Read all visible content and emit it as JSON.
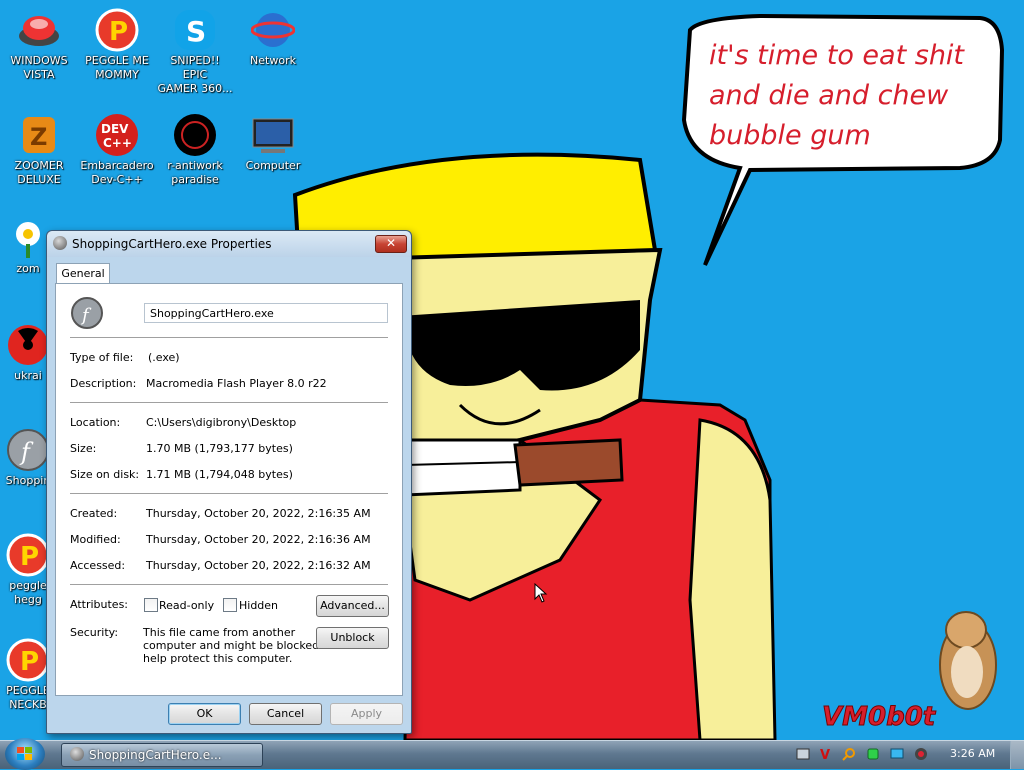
{
  "wallpaper": {
    "speech_lines": [
      "it's time to eat shit",
      "and die and chew",
      "bubble gum"
    ],
    "watermark": "VM0b0t"
  },
  "desktop_icons": [
    {
      "label": "WINDOWS\nVISTA",
      "icon": "vista-dome-icon"
    },
    {
      "label": "PEGGLE ME\nMOMMY",
      "icon": "peggle-icon"
    },
    {
      "label": "SNIPED!! EPIC\nGAMER 360...",
      "icon": "skype-icon"
    },
    {
      "label": "Network",
      "icon": "network-globe-icon"
    },
    {
      "label": "ZOOMER\nDELUXE",
      "icon": "zoomer-icon"
    },
    {
      "label": "Embarcadero\nDev-C++",
      "icon": "devcpp-icon"
    },
    {
      "label": "r-antiwork\nparadise",
      "icon": "antiwork-icon"
    },
    {
      "label": "Computer",
      "icon": "computer-icon"
    },
    {
      "label": "zom",
      "icon": "flower-icon"
    },
    {
      "label": "ukrai",
      "icon": "radiation-icon"
    },
    {
      "label": "Shoppin",
      "icon": "flash-icon"
    },
    {
      "label": "peggle\nhegg",
      "icon": "peggle-icon"
    },
    {
      "label": "PEGGLE\nNECKB",
      "icon": "peggle-icon"
    }
  ],
  "dialog": {
    "title": "ShoppingCartHero.exe Properties",
    "close_label": "✕",
    "tab_general": "General",
    "filename": "ShoppingCartHero.exe",
    "type_label": "Type of file:",
    "type_value": "(.exe)",
    "description_label": "Description:",
    "description_value": "Macromedia Flash Player 8.0  r22",
    "location_label": "Location:",
    "location_value": "C:\\Users\\digibrony\\Desktop",
    "size_label": "Size:",
    "size_value": "1.70 MB (1,793,177 bytes)",
    "size_on_disk_label": "Size on disk:",
    "size_on_disk_value": "1.71 MB (1,794,048 bytes)",
    "created_label": "Created:",
    "created_value": "Thursday, October 20, 2022, 2:16:35 AM",
    "modified_label": "Modified:",
    "modified_value": "Thursday, October 20, 2022, 2:16:36 AM",
    "accessed_label": "Accessed:",
    "accessed_value": "Thursday, October 20, 2022, 2:16:32 AM",
    "attributes_label": "Attributes:",
    "readonly_label": "Read-only",
    "hidden_label": "Hidden",
    "advanced_label": "Advanced...",
    "security_label": "Security:",
    "security_text_1": "This file came from another",
    "security_text_2": "computer and might be blocked to",
    "security_text_3": "help protect this computer.",
    "unblock_label": "Unblock",
    "ok_label": "OK",
    "cancel_label": "Cancel",
    "apply_label": "Apply"
  },
  "taskbar": {
    "task_label": "ShoppingCartHero.e...",
    "clock": "3:26 AM"
  }
}
